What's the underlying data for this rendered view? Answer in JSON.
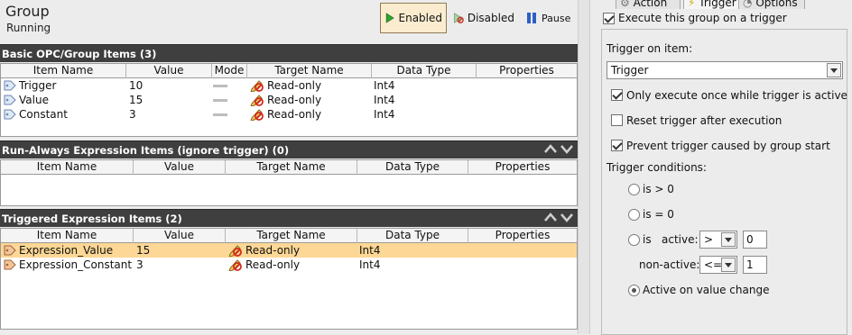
{
  "header": {
    "title": "Group",
    "status": "Running",
    "enabled_label": "Enabled",
    "disabled_label": "Disabled",
    "pause_label": "Pause"
  },
  "sections": {
    "basic": {
      "title": "Basic OPC/Group Items (3)",
      "columns": [
        "Item Name",
        "Value",
        "Mode",
        "Target Name",
        "Data Type",
        "Properties"
      ],
      "rows": [
        {
          "name": "Trigger",
          "value": "10",
          "target": "Read-only",
          "type": "Int4"
        },
        {
          "name": "Value",
          "value": "15",
          "target": "Read-only",
          "type": "Int4"
        },
        {
          "name": "Constant",
          "value": "3",
          "target": "Read-only",
          "type": "Int4"
        }
      ]
    },
    "run_always": {
      "title": "Run-Always Expression Items (ignore trigger) (0)",
      "columns": [
        "Item Name",
        "Value",
        "Target Name",
        "Data Type",
        "Properties"
      ]
    },
    "triggered": {
      "title": "Triggered Expression Items (2)",
      "columns": [
        "Item Name",
        "Value",
        "Target Name",
        "Data Type",
        "Properties"
      ],
      "rows": [
        {
          "name": "Expression_Value",
          "value": "15",
          "target": "Read-only",
          "type": "Int4"
        },
        {
          "name": "Expression_Constant",
          "value": "3",
          "target": "Read-only",
          "type": "Int4"
        }
      ]
    }
  },
  "right": {
    "tabs": [
      "Action",
      "Trigger",
      "Options"
    ],
    "execute_on_trigger": "Execute this group on a trigger",
    "trigger_on_item_label": "Trigger on item:",
    "trigger_item": "Trigger",
    "only_once": "Only execute once while trigger is active",
    "reset_after": "Reset trigger after execution",
    "prevent_start": "Prevent trigger caused by group start",
    "conditions_label": "Trigger conditions:",
    "is_gt_zero": "is > 0",
    "is_eq_zero": "is = 0",
    "is_label": "is",
    "active_label": "active:",
    "active_op": ">",
    "active_value": "0",
    "nonactive_label": "non-active:",
    "nonactive_op": "<=",
    "nonactive_value": "1",
    "on_change": "Active on value change"
  }
}
